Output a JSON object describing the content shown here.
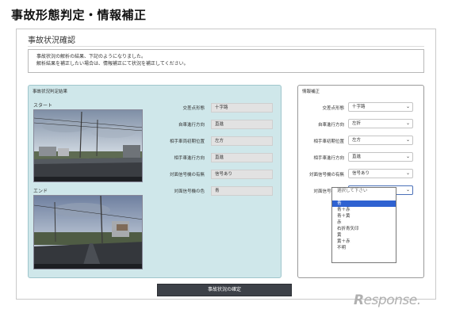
{
  "page": {
    "title": "事故形態判定・情報補正"
  },
  "frame": {
    "title": "事故状況確認",
    "notice_lines": [
      "事故状況の解析の結果、下記のようになりました。",
      "解析結果を補正したい場合は、情報補正にて状況を補正してください。"
    ]
  },
  "result_panel": {
    "title": "事故状況判定結果",
    "start_label": "スタート",
    "end_label": "エンド",
    "fields": [
      {
        "label": "交差点形態",
        "value": "十字路"
      },
      {
        "label": "自車進行方向",
        "value": "直進"
      },
      {
        "label": "相手車両初期位置",
        "value": "左方"
      },
      {
        "label": "相手車進行方向",
        "value": "直進"
      },
      {
        "label": "対面信号機の有無",
        "value": "信号あり"
      },
      {
        "label": "対面信号機の色",
        "value": "青"
      }
    ]
  },
  "fix_panel": {
    "title": "情報補正",
    "fields": [
      {
        "label": "交差点形態",
        "value": "十字路"
      },
      {
        "label": "自車進行方向",
        "value": "左折"
      },
      {
        "label": "相手車初期位置",
        "value": "左方"
      },
      {
        "label": "相手車進行方向",
        "value": "直進"
      },
      {
        "label": "対面信号機の有無",
        "value": "信号あり"
      },
      {
        "label": "対面信号機の色",
        "value": "青"
      }
    ],
    "dropdown_options": [
      "選択して下さい",
      "",
      "青",
      "青＋赤",
      "青＋黄",
      "赤",
      "右折青矢印",
      "黄",
      "黄＋赤",
      "不明"
    ],
    "selected_option": "青"
  },
  "actions": {
    "confirm_label": "事故状況の確定"
  },
  "watermark": {
    "text_r": "R",
    "text_rest": "esponse."
  },
  "colors": {
    "panel_bg": "#cfe7ea",
    "selected_option_bg": "#2f62d1",
    "button_bg": "#3d4148"
  }
}
